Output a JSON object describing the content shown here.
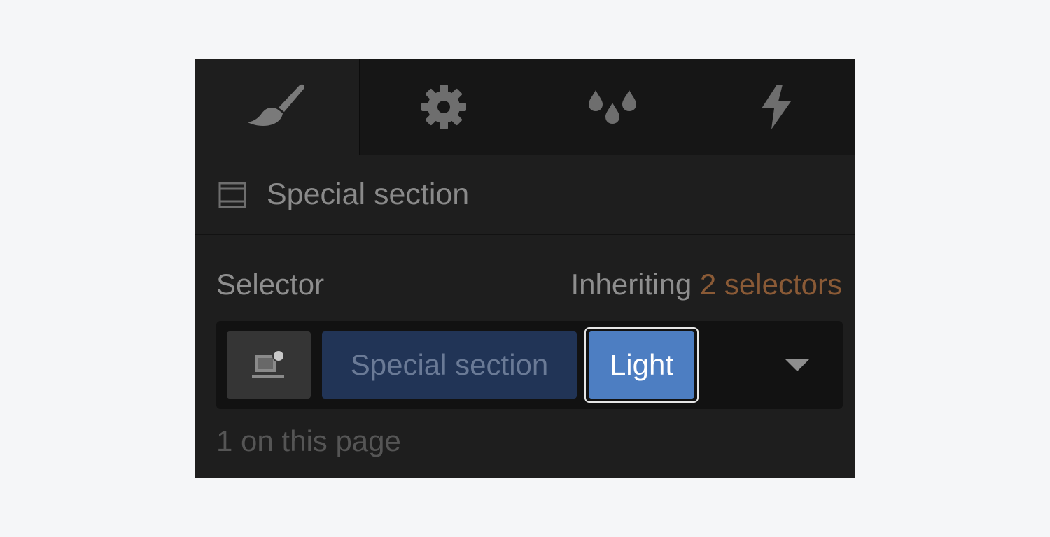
{
  "tabs": [
    {
      "icon": "paintbrush-icon",
      "active": true
    },
    {
      "icon": "gear-icon",
      "active": false
    },
    {
      "icon": "droplets-icon",
      "active": false
    },
    {
      "icon": "lightning-icon",
      "active": false
    }
  ],
  "element": {
    "icon": "section-icon",
    "name": "Special section"
  },
  "selector": {
    "label": "Selector",
    "inheriting_prefix": "Inheriting",
    "inheriting_link": "2 selectors",
    "state_icon": "state-selector-icon",
    "tags": [
      {
        "label": "Special section",
        "kind": "inherited"
      },
      {
        "label": "Light",
        "kind": "selected"
      }
    ],
    "count_text": "1 on this page"
  },
  "colors": {
    "panel_bg": "#1e1e1e",
    "tag_primary_bg": "#213456",
    "tag_selected_bg": "#4d7ec2",
    "link_color": "#8a5a36"
  }
}
